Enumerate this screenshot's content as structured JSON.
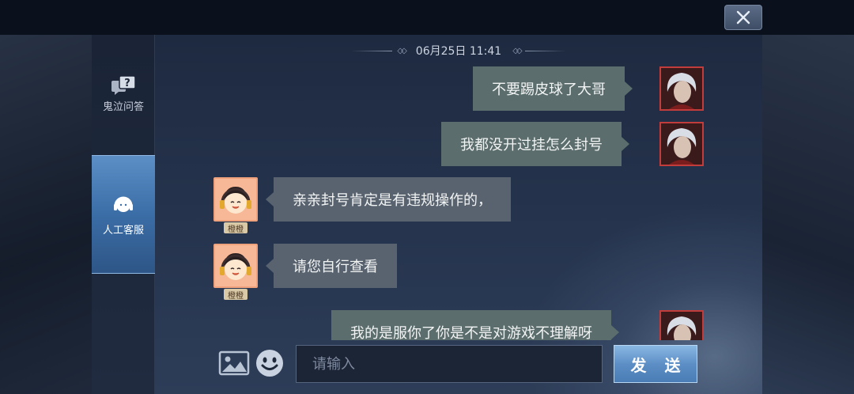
{
  "header": {
    "close_icon": "close-icon"
  },
  "sidebar": {
    "items": [
      {
        "label": "鬼泣问答",
        "icon": "question-chat-icon",
        "active": false
      },
      {
        "label": "人工客服",
        "icon": "headset-agent-icon",
        "active": true
      }
    ]
  },
  "chat": {
    "timestamp": "06月25日 11:41",
    "messages": [
      {
        "side": "right",
        "text": "不要踢皮球了大哥",
        "sender": "player"
      },
      {
        "side": "right",
        "text": "我都没开过挂怎么封号",
        "sender": "player"
      },
      {
        "side": "left",
        "text": "亲亲封号肯定是有违规操作的，",
        "sender": "agent",
        "name": "橙橙"
      },
      {
        "side": "left",
        "text": "请您自行查看",
        "sender": "agent",
        "name": "橙橙"
      },
      {
        "side": "right",
        "text": "我的是服你了你是不是对游戏不理解呀",
        "sender": "player"
      }
    ]
  },
  "composer": {
    "placeholder": "请输入",
    "send_label": "发 送",
    "image_icon": "image-icon",
    "emoji_icon": "emoji-icon"
  },
  "colors": {
    "accent": "#5d8fc6",
    "bubble_player": "#5b6d6c",
    "bubble_agent": "#59636f",
    "panel": "#26344e"
  }
}
